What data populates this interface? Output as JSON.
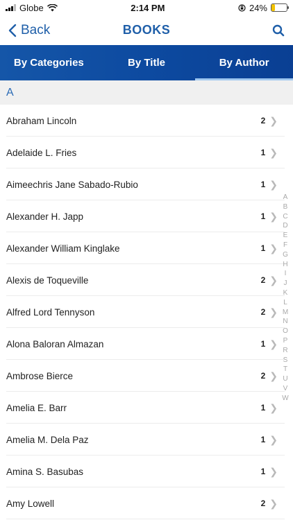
{
  "status": {
    "carrier": "Globe",
    "time": "2:14 PM",
    "battery": "24%",
    "battery_fraction": 0.24
  },
  "nav": {
    "back_label": "Back",
    "title": "BOOKS"
  },
  "tabs": [
    {
      "label": "By Categories",
      "active": false
    },
    {
      "label": "By Title",
      "active": false
    },
    {
      "label": "By Author",
      "active": true
    }
  ],
  "section": {
    "letter": "A"
  },
  "authors": [
    {
      "name": "Abraham Lincoln",
      "count": "2"
    },
    {
      "name": "Adelaide L. Fries",
      "count": "1"
    },
    {
      "name": "Aimeechris Jane Sabado-Rubio",
      "count": "1"
    },
    {
      "name": "Alexander H. Japp",
      "count": "1"
    },
    {
      "name": "Alexander William Kinglake",
      "count": "1"
    },
    {
      "name": "Alexis de Toqueville",
      "count": "2"
    },
    {
      "name": "Alfred Lord Tennyson",
      "count": "2"
    },
    {
      "name": "Alona Baloran Almazan",
      "count": "1"
    },
    {
      "name": "Ambrose Bierce",
      "count": "2"
    },
    {
      "name": "Amelia E. Barr",
      "count": "1"
    },
    {
      "name": "Amelia M. Dela Paz",
      "count": "1"
    },
    {
      "name": "Amina S. Basubas",
      "count": "1"
    },
    {
      "name": "Amy Lowell",
      "count": "2"
    }
  ],
  "index_letters": [
    "A",
    "B",
    "C",
    "D",
    "E",
    "F",
    "G",
    "H",
    "I",
    "J",
    "K",
    "L",
    "M",
    "N",
    "O",
    "P",
    "R",
    "S",
    "T",
    "U",
    "V",
    "W"
  ],
  "colors": {
    "accent": "#1f5fa9",
    "tab_bar": "#0d4aa0",
    "tab_indicator": "#9fc7ef"
  }
}
